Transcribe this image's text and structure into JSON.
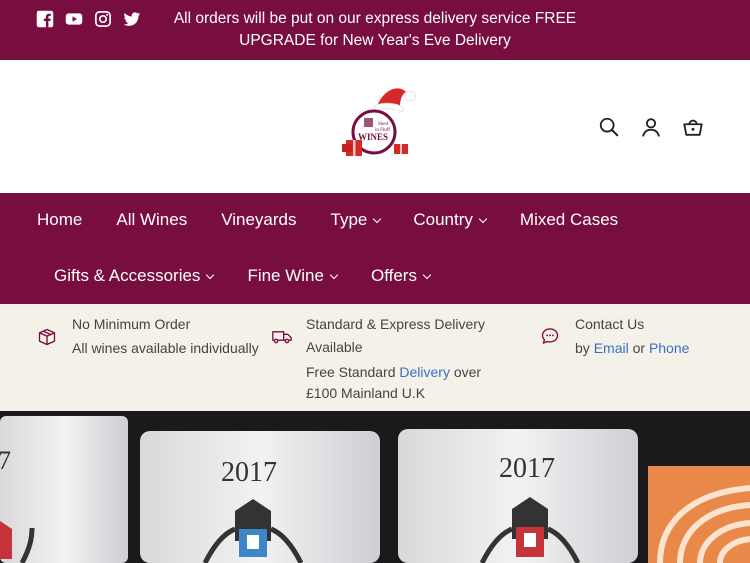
{
  "announcement": {
    "line1": "All orders will be put on our express delivery service FREE",
    "line2": "UPGRADE for New Year's Eve Delivery",
    "social_icons": [
      "facebook-icon",
      "youtube-icon",
      "instagram-icon",
      "twitter-icon"
    ]
  },
  "header": {
    "logo_text": "WINES",
    "logo_small": "Shed in Fluff",
    "icons": [
      "search-icon",
      "account-icon",
      "cart-icon"
    ]
  },
  "nav": {
    "row1": [
      {
        "label": "Home",
        "dropdown": false
      },
      {
        "label": "All Wines",
        "dropdown": false
      },
      {
        "label": "Vineyards",
        "dropdown": false
      },
      {
        "label": "Type",
        "dropdown": true
      },
      {
        "label": "Country",
        "dropdown": true
      },
      {
        "label": "Mixed Cases",
        "dropdown": false
      }
    ],
    "row2": [
      {
        "label": "Gifts & Accessories",
        "dropdown": true
      },
      {
        "label": "Fine Wine",
        "dropdown": true
      },
      {
        "label": "Offers",
        "dropdown": true
      }
    ]
  },
  "info": {
    "col1": {
      "title": "No Minimum Order",
      "line2": "All wines available individually"
    },
    "col2": {
      "title_l1": "Standard & Express Delivery",
      "title_l2": "Available",
      "free_prefix": "Free Standard ",
      "free_link": "Delivery",
      "free_suffix": " over",
      "free_l2": "£100 Mainland U.K"
    },
    "col3": {
      "title": "Contact Us",
      "by": "by ",
      "email": "Email",
      "or": " or ",
      "phone": "Phone"
    }
  },
  "hero": {
    "label1": "2017",
    "label2": "2017",
    "label3": "7"
  },
  "colors": {
    "brand": "#780d3f",
    "info_bg": "#f4f1e8",
    "link": "#3b6fc7"
  }
}
